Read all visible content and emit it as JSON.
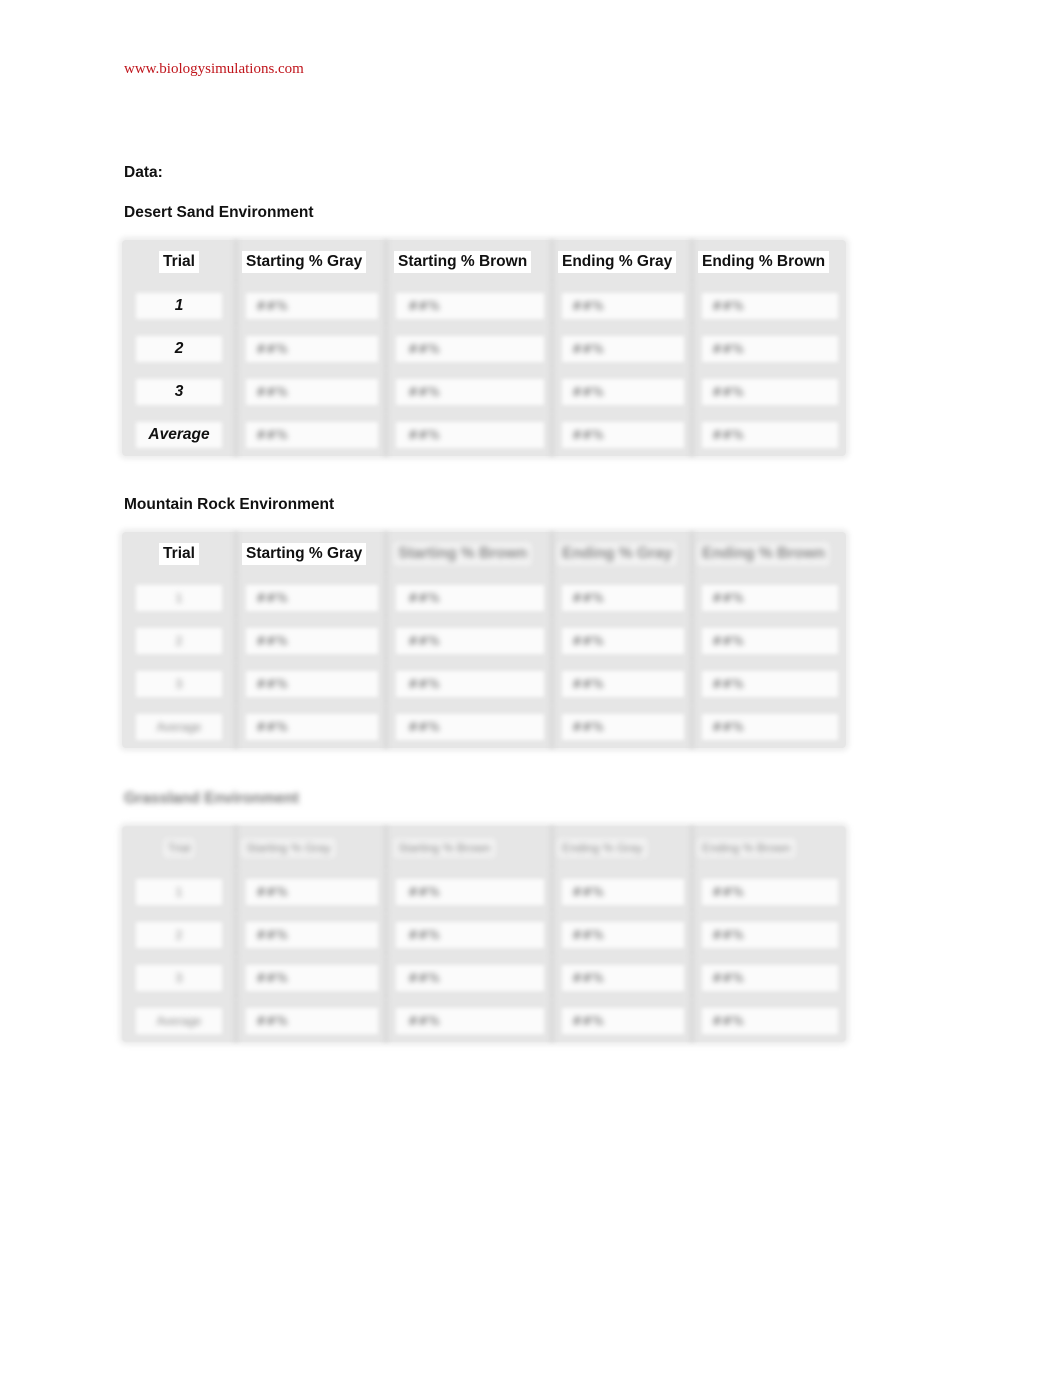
{
  "header": {
    "site_link": "www.biologysimulations.com"
  },
  "document": {
    "section_label": "Data:",
    "tables": [
      {
        "title": "Desert Sand Environment",
        "title_legible": true,
        "columns": [
          "Trial",
          "Starting % Gray",
          "Starting % Brown",
          "Ending % Gray",
          "Ending % Brown"
        ],
        "columns_legible": [
          true,
          true,
          true,
          true,
          true
        ],
        "rows": [
          {
            "trial": "1",
            "values": [
              "##%",
              "##%",
              "##%",
              "##%"
            ]
          },
          {
            "trial": "2",
            "values": [
              "##%",
              "##%",
              "##%",
              "##%"
            ]
          },
          {
            "trial": "3",
            "values": [
              "##%",
              "##%",
              "##%",
              "##%"
            ]
          },
          {
            "trial": "Average",
            "values": [
              "##%",
              "##%",
              "##%",
              "##%"
            ]
          }
        ],
        "trial_legible": true,
        "values_blurred": true
      },
      {
        "title": "Mountain Rock Environment",
        "title_legible": true,
        "columns": [
          "Trial",
          "Starting % Gray",
          "Starting % Brown",
          "Ending % Gray",
          "Ending % Brown"
        ],
        "columns_legible": [
          true,
          true,
          false,
          false,
          false
        ],
        "rows": [
          {
            "trial": "1",
            "values": [
              "##%",
              "##%",
              "##%",
              "##%"
            ]
          },
          {
            "trial": "2",
            "values": [
              "##%",
              "##%",
              "##%",
              "##%"
            ]
          },
          {
            "trial": "3",
            "values": [
              "##%",
              "##%",
              "##%",
              "##%"
            ]
          },
          {
            "trial": "Average",
            "values": [
              "##%",
              "##%",
              "##%",
              "##%"
            ]
          }
        ],
        "trial_legible": false,
        "values_blurred": true
      },
      {
        "title": "Grassland Environment",
        "title_legible": false,
        "columns": [
          "Trial",
          "Starting % Gray",
          "Starting % Brown",
          "Ending % Gray",
          "Ending % Brown"
        ],
        "columns_legible": [
          false,
          false,
          false,
          false,
          false
        ],
        "rows": [
          {
            "trial": "1",
            "values": [
              "##%",
              "##%",
              "##%",
              "##%"
            ]
          },
          {
            "trial": "2",
            "values": [
              "##%",
              "##%",
              "##%",
              "##%"
            ]
          },
          {
            "trial": "3",
            "values": [
              "##%",
              "##%",
              "##%",
              "##%"
            ]
          },
          {
            "trial": "Average",
            "values": [
              "##%",
              "##%",
              "##%",
              "##%"
            ]
          }
        ],
        "trial_legible": false,
        "values_blurred": true
      }
    ]
  },
  "colors": {
    "link": "#c0151c",
    "text": "#111111",
    "table_grid": "#e6e6e6"
  }
}
